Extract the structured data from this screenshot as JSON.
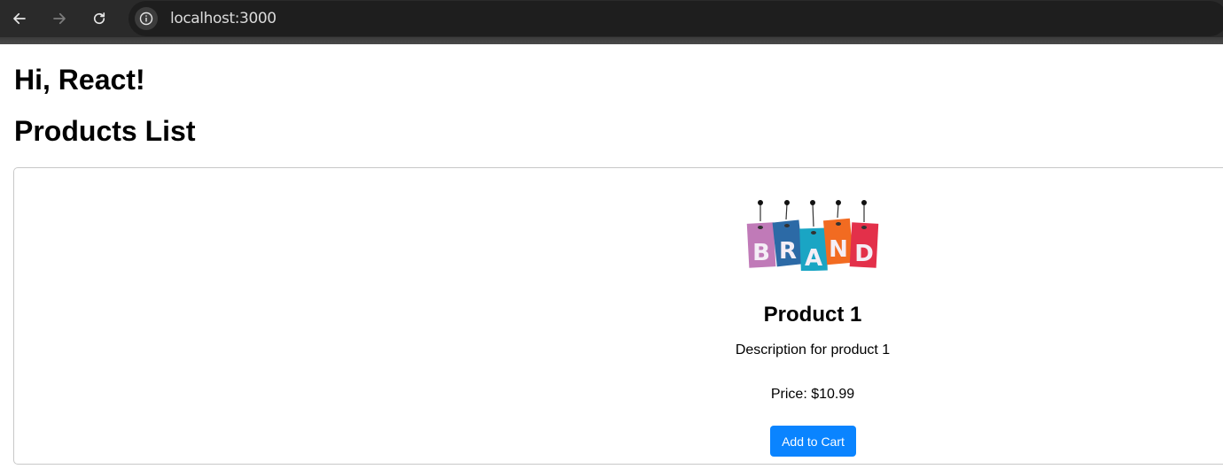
{
  "browser": {
    "url": "localhost:3000",
    "back_icon": "arrow-left-icon",
    "forward_icon": "arrow-right-icon",
    "reload_icon": "reload-icon",
    "info_icon": "info-icon"
  },
  "page": {
    "greeting": "Hi, React!",
    "section_title": "Products List"
  },
  "products": [
    {
      "image_text": "BRAND",
      "name": "Product 1",
      "description": "Description for product 1",
      "price_text": "Price: $10.99",
      "button_label": "Add to Cart"
    }
  ],
  "colors": {
    "button_bg": "#0a84ff",
    "button_text": "#ffffff",
    "toolbar_bg": "#2a2a2a"
  }
}
